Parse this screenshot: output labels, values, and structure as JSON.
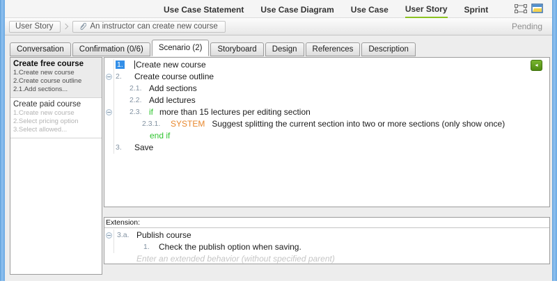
{
  "top_nav": {
    "tabs": [
      {
        "label": "Use Case Statement",
        "active": false
      },
      {
        "label": "Use Case Diagram",
        "active": false
      },
      {
        "label": "Use Case",
        "active": false
      },
      {
        "label": "User Story",
        "active": true
      },
      {
        "label": "Sprint",
        "active": false
      }
    ]
  },
  "breadcrumb": {
    "root": "User Story",
    "current": "An instructor can create new course",
    "status": "Pending"
  },
  "doc_tabs": [
    {
      "label": "Conversation",
      "active": false
    },
    {
      "label": "Confirmation (0/6)",
      "active": false
    },
    {
      "label": "Scenario (2)",
      "active": true
    },
    {
      "label": "Storyboard",
      "active": false
    },
    {
      "label": "Design",
      "active": false
    },
    {
      "label": "References",
      "active": false
    },
    {
      "label": "Description",
      "active": false
    }
  ],
  "scenario_list": [
    {
      "title": "Create free course",
      "preview": "1.Create new course 2.Create course outline 2.1.Add sections...",
      "selected": true
    },
    {
      "title": "Create paid course",
      "preview": "1.Create new course 2.Select pricing option 3.Select allowed...",
      "selected": false
    }
  ],
  "editor": {
    "steps": [
      {
        "num": "1.",
        "text": "Create new course",
        "selected": true
      },
      {
        "num": "2.",
        "text": "Create course outline",
        "collapsible": true
      },
      {
        "num": "2.1.",
        "text": "Add sections"
      },
      {
        "num": "2.2.",
        "text": "Add lectures"
      },
      {
        "num": "2.3.",
        "keyword": "if",
        "text": "more than 15 lectures per editing section",
        "collapsible": true
      },
      {
        "num": "2.3.1.",
        "keyword": "SYSTEM",
        "text": "Suggest splitting the current section into two or more sections (only show once)"
      },
      {
        "keyword": "end if"
      },
      {
        "num": "3.",
        "text": "Save"
      }
    ]
  },
  "extension": {
    "label": "Extension:",
    "steps": [
      {
        "num": "3.a.",
        "text": "Publish course",
        "collapsible": true
      },
      {
        "num": "1.",
        "text": "Check the publish option when saving."
      }
    ],
    "placeholder": "Enter an extended behavior (without specified parent)"
  },
  "colors": {
    "accent_green": "#8cc220",
    "selection_blue": "#338fe8",
    "keyword_green": "#2fc42f",
    "system_orange": "#e8872d",
    "number_gray": "#8292a2",
    "frame_blue": "#74afe8",
    "status_gray": "#8f8f8f"
  }
}
